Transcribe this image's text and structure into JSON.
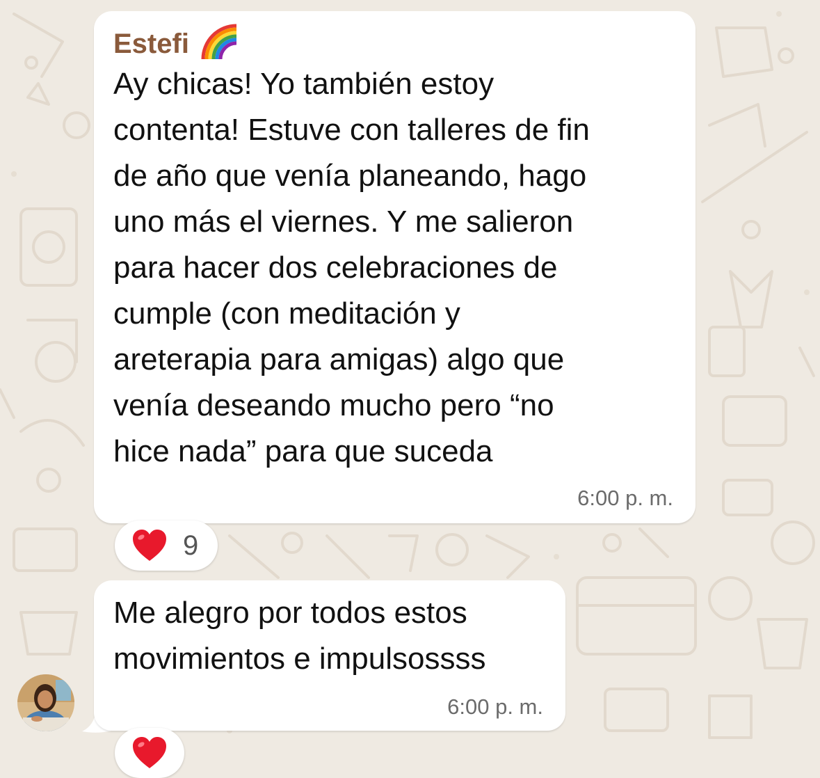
{
  "chat": {
    "messages": [
      {
        "sender": "Estefi",
        "sender_emoji": "rainbow",
        "lines": [
          "Ay chicas! Yo también estoy",
          "contenta! Estuve con talleres de fin",
          "de año que venía planeando, hago",
          "uno más el viernes. Y me salieron",
          "para hacer dos celebraciones de",
          "cumple (con meditación y",
          "areterapia para amigas) algo que",
          "venía deseando mucho pero “no",
          "hice nada” para que suceda"
        ],
        "time": "6:00 p. m.",
        "reaction": {
          "emoji": "red-heart",
          "count": "9"
        }
      },
      {
        "lines": [
          "Me alegro por todos estos",
          "movimientos e impulsossss"
        ],
        "time": "6:00 p. m.",
        "reaction": {
          "emoji": "red-heart"
        }
      }
    ]
  },
  "colors": {
    "wallpaper": "#efeae2",
    "bubble": "#ffffff",
    "sender_name": "#8a5a3b",
    "text": "#111111",
    "timestamp": "#6b6b6b"
  }
}
